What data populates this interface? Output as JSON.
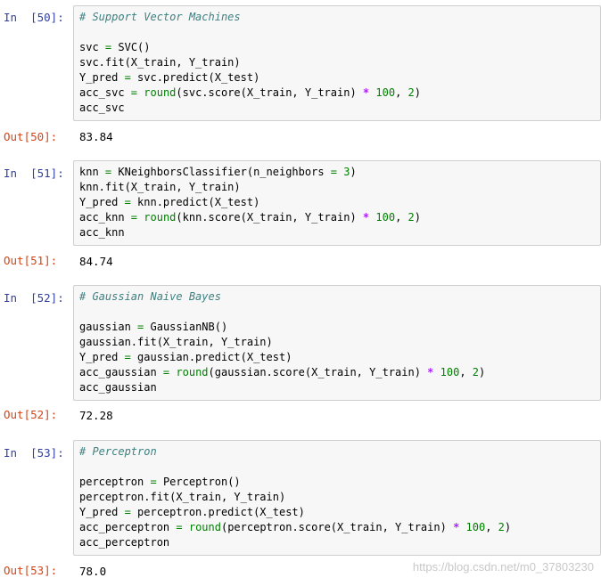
{
  "cells": [
    {
      "in_prompt": "In  [50]:",
      "out_prompt": "Out[50]:",
      "output": "83.84",
      "lines": [
        [
          {
            "t": "# Support Vector Machines",
            "c": "comment"
          }
        ],
        [],
        [
          {
            "t": "svc "
          },
          {
            "t": "=",
            "c": "kw"
          },
          {
            "t": " SVC()"
          }
        ],
        [
          {
            "t": "svc.fit(X_train, Y_train)"
          }
        ],
        [
          {
            "t": "Y_pred "
          },
          {
            "t": "=",
            "c": "kw"
          },
          {
            "t": " svc.predict(X_test)"
          }
        ],
        [
          {
            "t": "acc_svc "
          },
          {
            "t": "=",
            "c": "kw"
          },
          {
            "t": " "
          },
          {
            "t": "round",
            "c": "kw"
          },
          {
            "t": "(svc.score(X_train, Y_train) "
          },
          {
            "t": "*",
            "c": "op"
          },
          {
            "t": " "
          },
          {
            "t": "100",
            "c": "num"
          },
          {
            "t": ", "
          },
          {
            "t": "2",
            "c": "num"
          },
          {
            "t": ")"
          }
        ],
        [
          {
            "t": "acc_svc"
          }
        ]
      ]
    },
    {
      "in_prompt": "In  [51]:",
      "out_prompt": "Out[51]:",
      "output": "84.74",
      "lines": [
        [
          {
            "t": "knn "
          },
          {
            "t": "=",
            "c": "kw"
          },
          {
            "t": " KNeighborsClassifier(n_neighbors "
          },
          {
            "t": "=",
            "c": "kw"
          },
          {
            "t": " "
          },
          {
            "t": "3",
            "c": "num"
          },
          {
            "t": ")"
          }
        ],
        [
          {
            "t": "knn.fit(X_train, Y_train)"
          }
        ],
        [
          {
            "t": "Y_pred "
          },
          {
            "t": "=",
            "c": "kw"
          },
          {
            "t": " knn.predict(X_test)"
          }
        ],
        [
          {
            "t": "acc_knn "
          },
          {
            "t": "=",
            "c": "kw"
          },
          {
            "t": " "
          },
          {
            "t": "round",
            "c": "kw"
          },
          {
            "t": "(knn.score(X_train, Y_train) "
          },
          {
            "t": "*",
            "c": "op"
          },
          {
            "t": " "
          },
          {
            "t": "100",
            "c": "num"
          },
          {
            "t": ", "
          },
          {
            "t": "2",
            "c": "num"
          },
          {
            "t": ")"
          }
        ],
        [
          {
            "t": "acc_knn"
          }
        ]
      ]
    },
    {
      "in_prompt": "In  [52]:",
      "out_prompt": "Out[52]:",
      "output": "72.28",
      "lines": [
        [
          {
            "t": "# Gaussian Naive Bayes",
            "c": "comment"
          }
        ],
        [],
        [
          {
            "t": "gaussian "
          },
          {
            "t": "=",
            "c": "kw"
          },
          {
            "t": " GaussianNB()"
          }
        ],
        [
          {
            "t": "gaussian.fit(X_train, Y_train)"
          }
        ],
        [
          {
            "t": "Y_pred "
          },
          {
            "t": "=",
            "c": "kw"
          },
          {
            "t": " gaussian.predict(X_test)"
          }
        ],
        [
          {
            "t": "acc_gaussian "
          },
          {
            "t": "=",
            "c": "kw"
          },
          {
            "t": " "
          },
          {
            "t": "round",
            "c": "kw"
          },
          {
            "t": "(gaussian.score(X_train, Y_train) "
          },
          {
            "t": "*",
            "c": "op"
          },
          {
            "t": " "
          },
          {
            "t": "100",
            "c": "num"
          },
          {
            "t": ", "
          },
          {
            "t": "2",
            "c": "num"
          },
          {
            "t": ")"
          }
        ],
        [
          {
            "t": "acc_gaussian"
          }
        ]
      ]
    },
    {
      "in_prompt": "In  [53]:",
      "out_prompt": "Out[53]:",
      "output": "78.0",
      "lines": [
        [
          {
            "t": "# Perceptron",
            "c": "comment"
          }
        ],
        [],
        [
          {
            "t": "perceptron "
          },
          {
            "t": "=",
            "c": "kw"
          },
          {
            "t": " Perceptron()"
          }
        ],
        [
          {
            "t": "perceptron.fit(X_train, Y_train)"
          }
        ],
        [
          {
            "t": "Y_pred "
          },
          {
            "t": "=",
            "c": "kw"
          },
          {
            "t": " perceptron.predict(X_test)"
          }
        ],
        [
          {
            "t": "acc_perceptron "
          },
          {
            "t": "=",
            "c": "kw"
          },
          {
            "t": " "
          },
          {
            "t": "round",
            "c": "kw"
          },
          {
            "t": "(perceptron.score(X_train, Y_train) "
          },
          {
            "t": "*",
            "c": "op"
          },
          {
            "t": " "
          },
          {
            "t": "100",
            "c": "num"
          },
          {
            "t": ", "
          },
          {
            "t": "2",
            "c": "num"
          },
          {
            "t": ")"
          }
        ],
        [
          {
            "t": "acc_perceptron"
          }
        ]
      ]
    }
  ],
  "watermark": "https://blog.csdn.net/m0_37803230"
}
